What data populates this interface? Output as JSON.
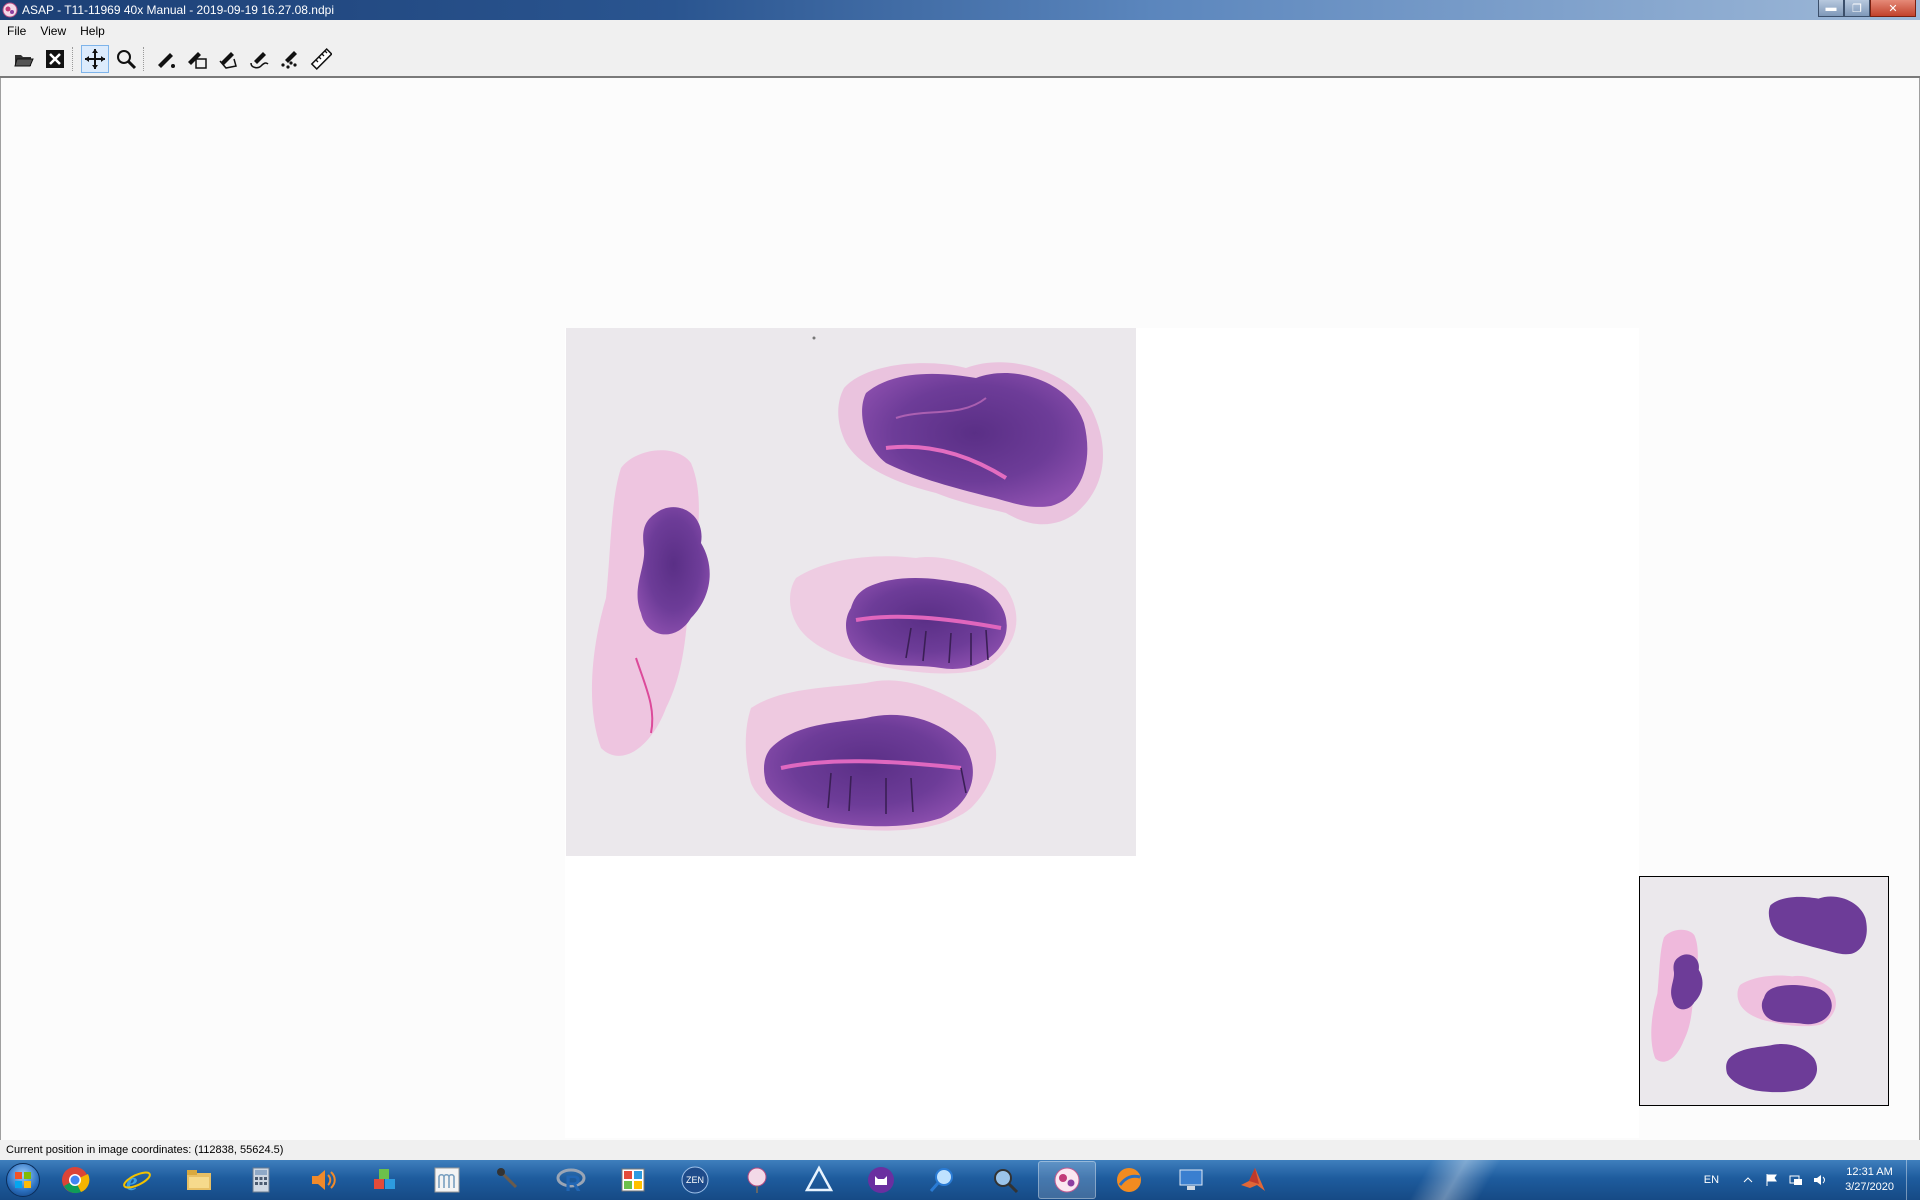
{
  "window": {
    "title": "ASAP - T11-11969 40x Manual - 2019-09-19 16.27.08.ndpi",
    "controls": {
      "minimize": "▬",
      "maximize": "❐",
      "close": "✕"
    }
  },
  "menu": [
    "File",
    "View",
    "Help"
  ],
  "toolbar": {
    "tools": [
      {
        "name": "open-folder-icon",
        "active": false
      },
      {
        "name": "close-image-icon",
        "active": false
      },
      {
        "name": "pan-icon",
        "active": true
      },
      {
        "name": "zoom-icon",
        "active": false
      },
      {
        "name": "dot-annotation-icon",
        "active": false
      },
      {
        "name": "rectangle-annotation-icon",
        "active": false
      },
      {
        "name": "polygon-annotation-icon",
        "active": false
      },
      {
        "name": "spline-annotation-icon",
        "active": false
      },
      {
        "name": "pointset-annotation-icon",
        "active": false
      },
      {
        "name": "ruler-icon",
        "active": false
      }
    ]
  },
  "status": {
    "text": "Current position in image coordinates: (112838, 55624.5)"
  },
  "taskbar": {
    "apps": [
      {
        "name": "chrome-icon",
        "open": false
      },
      {
        "name": "internet-explorer-icon",
        "open": false
      },
      {
        "name": "file-explorer-icon",
        "open": false
      },
      {
        "name": "calculator-icon",
        "open": false
      },
      {
        "name": "speaker-app-icon",
        "open": false
      },
      {
        "name": "cubes-app-icon",
        "open": false
      },
      {
        "name": "mu-app-icon",
        "open": false
      },
      {
        "name": "microphone-app-icon",
        "open": false
      },
      {
        "name": "r-language-icon",
        "open": false
      },
      {
        "name": "paint-app-icon",
        "open": false
      },
      {
        "name": "zen-app-icon",
        "open": false,
        "label": "ZEN"
      },
      {
        "name": "microscope-app-icon",
        "open": false
      },
      {
        "name": "triangle-app-icon",
        "open": false
      },
      {
        "name": "cat-app-icon",
        "open": false
      },
      {
        "name": "search-app-icon",
        "open": false
      },
      {
        "name": "magnifier-globe-icon",
        "open": false
      },
      {
        "name": "asap-app-icon",
        "open": true
      },
      {
        "name": "orange-app-icon",
        "open": false
      },
      {
        "name": "remote-desktop-icon",
        "open": false
      },
      {
        "name": "matlab-icon",
        "open": false
      }
    ],
    "tray": {
      "language": "EN",
      "time": "12:31 AM",
      "date": "3/27/2020"
    }
  },
  "colors": {
    "titlebar": "#1c3f75",
    "tissue_dark": "#6a3a94",
    "tissue_mid": "#9a57b3",
    "tissue_pink": "#e48ccb",
    "slide_background": "#ebe8ec"
  }
}
